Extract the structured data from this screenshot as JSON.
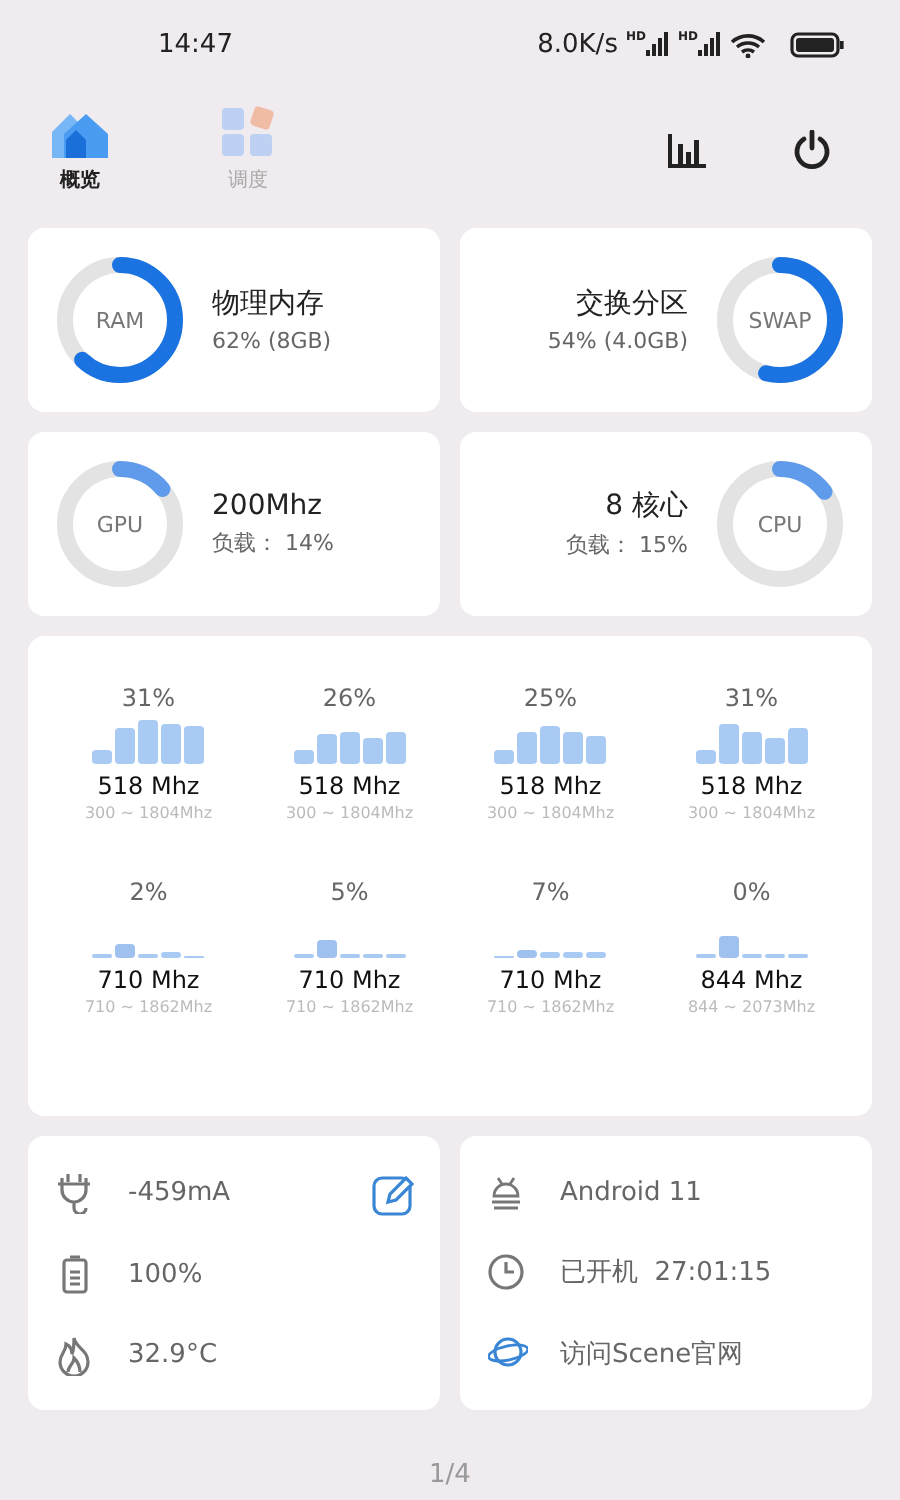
{
  "status_bar": {
    "time": "14:47",
    "speed": "8.0K/s",
    "sims": [
      {
        "label": "HD"
      },
      {
        "label": "HD"
      }
    ]
  },
  "tabs": [
    {
      "label": "概览",
      "selected": true
    },
    {
      "label": "调度",
      "selected": false
    }
  ],
  "gauges": [
    {
      "ring_label": "RAM",
      "title": "物理内存",
      "detail": "62% (8GB)",
      "color": "#1a73e0"
    },
    {
      "ring_label": "SWAP",
      "title": "交换分区",
      "detail": "54% (4.0GB)",
      "color": "#1a73e0"
    },
    {
      "ring_label": "GPU",
      "title": "200Mhz",
      "detail": "负载： 14%",
      "color": "#5f9bea"
    },
    {
      "ring_label": "CPU",
      "title": "8 核心",
      "detail": "负载： 15%",
      "color": "#5f9bea"
    }
  ],
  "cores": [
    {
      "load": "31%",
      "freq": "518 Mhz",
      "range": "300 ~ 1804Mhz"
    },
    {
      "load": "26%",
      "freq": "518 Mhz",
      "range": "300 ~ 1804Mhz"
    },
    {
      "load": "25%",
      "freq": "518 Mhz",
      "range": "300 ~ 1804Mhz"
    },
    {
      "load": "31%",
      "freq": "518 Mhz",
      "range": "300 ~ 1804Mhz"
    },
    {
      "load": "2%",
      "freq": "710 Mhz",
      "range": "710 ~ 1862Mhz"
    },
    {
      "load": "5%",
      "freq": "710 Mhz",
      "range": "710 ~ 1862Mhz"
    },
    {
      "load": "7%",
      "freq": "710 Mhz",
      "range": "710 ~ 1862Mhz"
    },
    {
      "load": "0%",
      "freq": "844 Mhz",
      "range": "844 ~ 2073Mhz"
    }
  ],
  "battery_info": [
    {
      "kind": "current",
      "text": "-459mA"
    },
    {
      "kind": "battery",
      "text": "100%"
    },
    {
      "kind": "temperature",
      "text": "32.9°C"
    }
  ],
  "system_info": [
    {
      "kind": "android",
      "text": "Android 11"
    },
    {
      "kind": "uptime",
      "text": "已开机  27:01:15"
    },
    {
      "kind": "website",
      "text": "访问Scene官网"
    }
  ],
  "page_indicator": "1/4"
}
